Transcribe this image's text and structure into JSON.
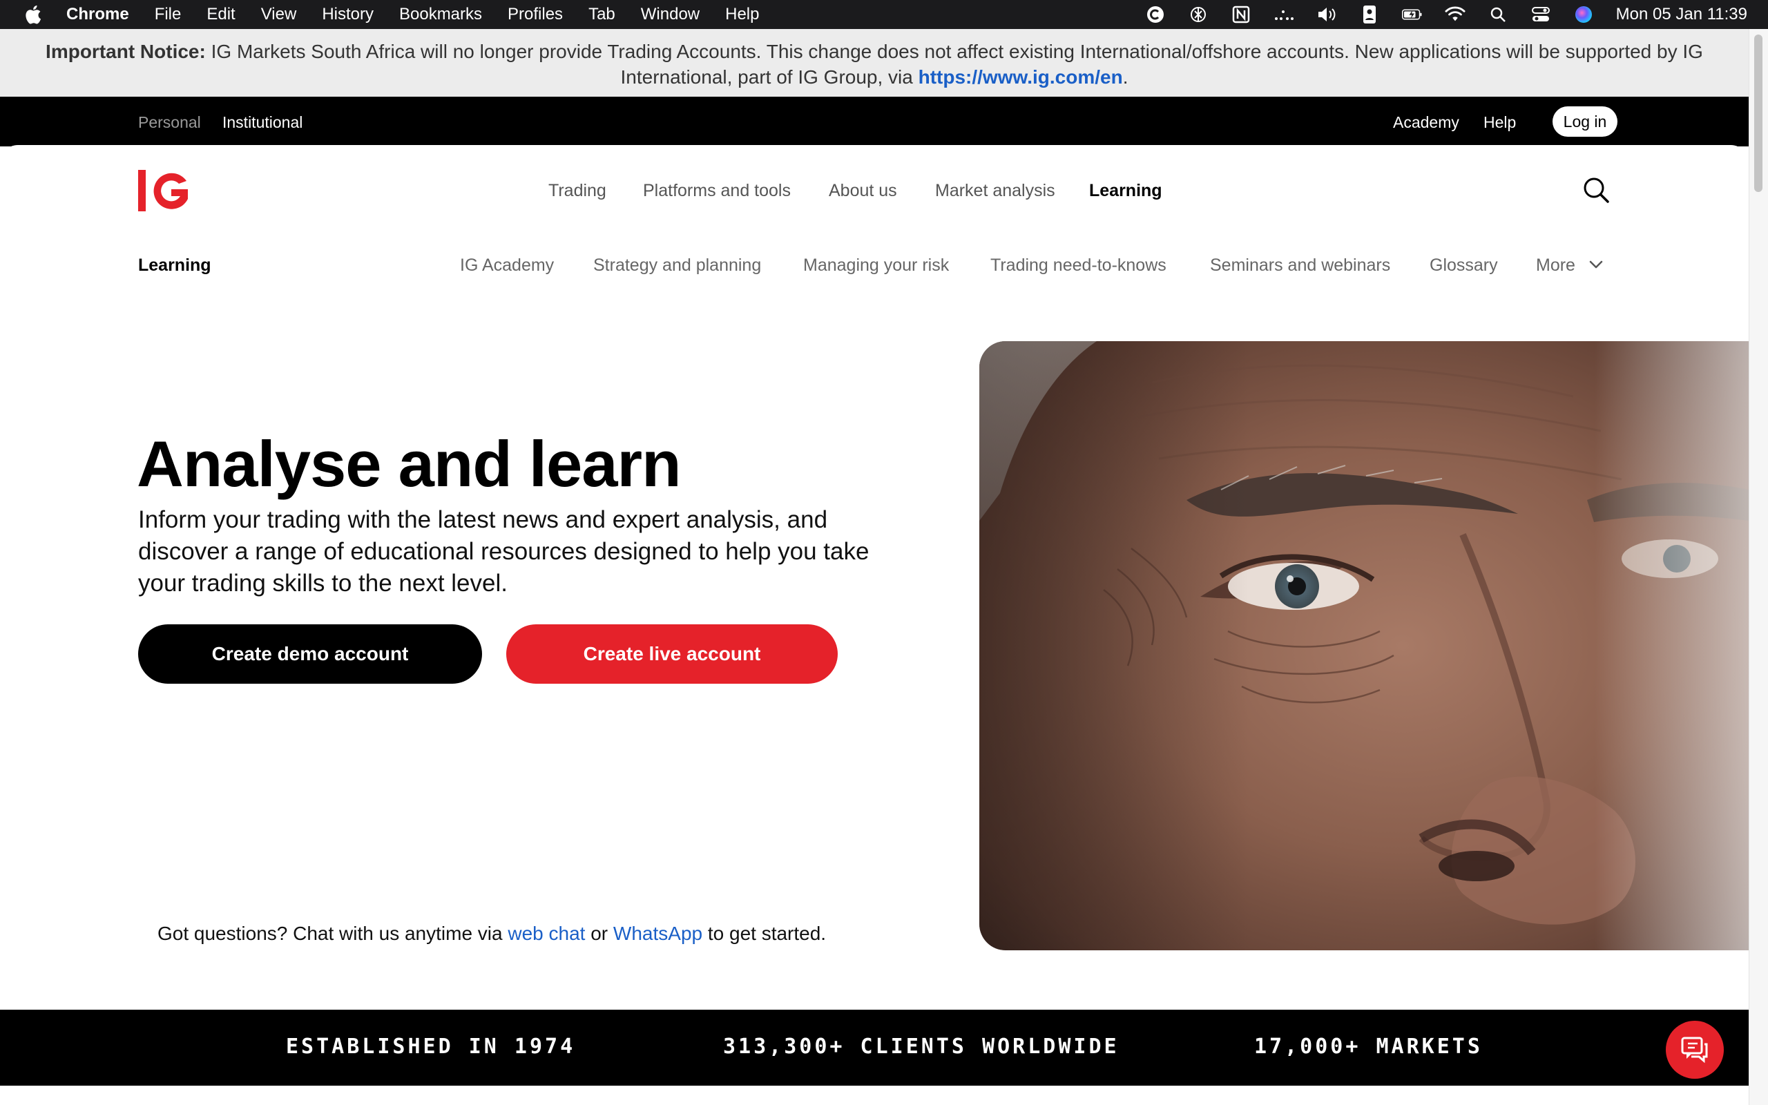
{
  "menubar": {
    "app_name": "Chrome",
    "menus": [
      "File",
      "Edit",
      "View",
      "History",
      "Bookmarks",
      "Profiles",
      "Tab",
      "Window",
      "Help"
    ],
    "status_icons": [
      "c-circle-icon",
      "openai-icon",
      "notion-icon",
      "dots-icon",
      "volume-icon",
      "battery-person-icon",
      "battery-charging-icon",
      "wifi-icon",
      "spotlight-search-icon",
      "control-center-icon",
      "siri-icon"
    ],
    "clock": "Mon 05 Jan  11:39"
  },
  "notice": {
    "label": "Important Notice:",
    "text": " IG Markets South Africa will no longer provide Trading Accounts. This change does not affect existing International/offshore accounts. New applications will be supported by IG International, part of IG Group, via ",
    "link": "https://www.ig.com/en",
    "suffix": "."
  },
  "topbar": {
    "personal": "Personal",
    "institutional": "Institutional",
    "academy": "Academy",
    "help": "Help",
    "login": "Log in"
  },
  "brand": {
    "logo_text": "IG",
    "accent_color": "#e5222a"
  },
  "main_nav": [
    "Trading",
    "Platforms and tools",
    "About us",
    "Market analysis",
    "Learning"
  ],
  "sub_nav": {
    "title": "Learning",
    "items": [
      "IG Academy",
      "Strategy and planning",
      "Managing your risk",
      "Trading need-to-knows",
      "Seminars and webinars",
      "Glossary"
    ],
    "more": "More"
  },
  "hero": {
    "title": "Analyse and learn",
    "description": "Inform your trading with the latest news and expert analysis, and discover a range of educational resources designed to help you take your trading skills to the next level.",
    "demo_button": "Create demo account",
    "live_button": "Create live account"
  },
  "chat": {
    "prefix": "Got questions? Chat with us anytime via ",
    "web_chat": "web chat",
    "or": " or ",
    "whatsapp": "WhatsApp",
    "suffix": " to get started."
  },
  "stats": [
    "ESTABLISHED IN 1974",
    "313,300+ CLIENTS WORLDWIDE",
    "17,000+ MARKETS"
  ]
}
